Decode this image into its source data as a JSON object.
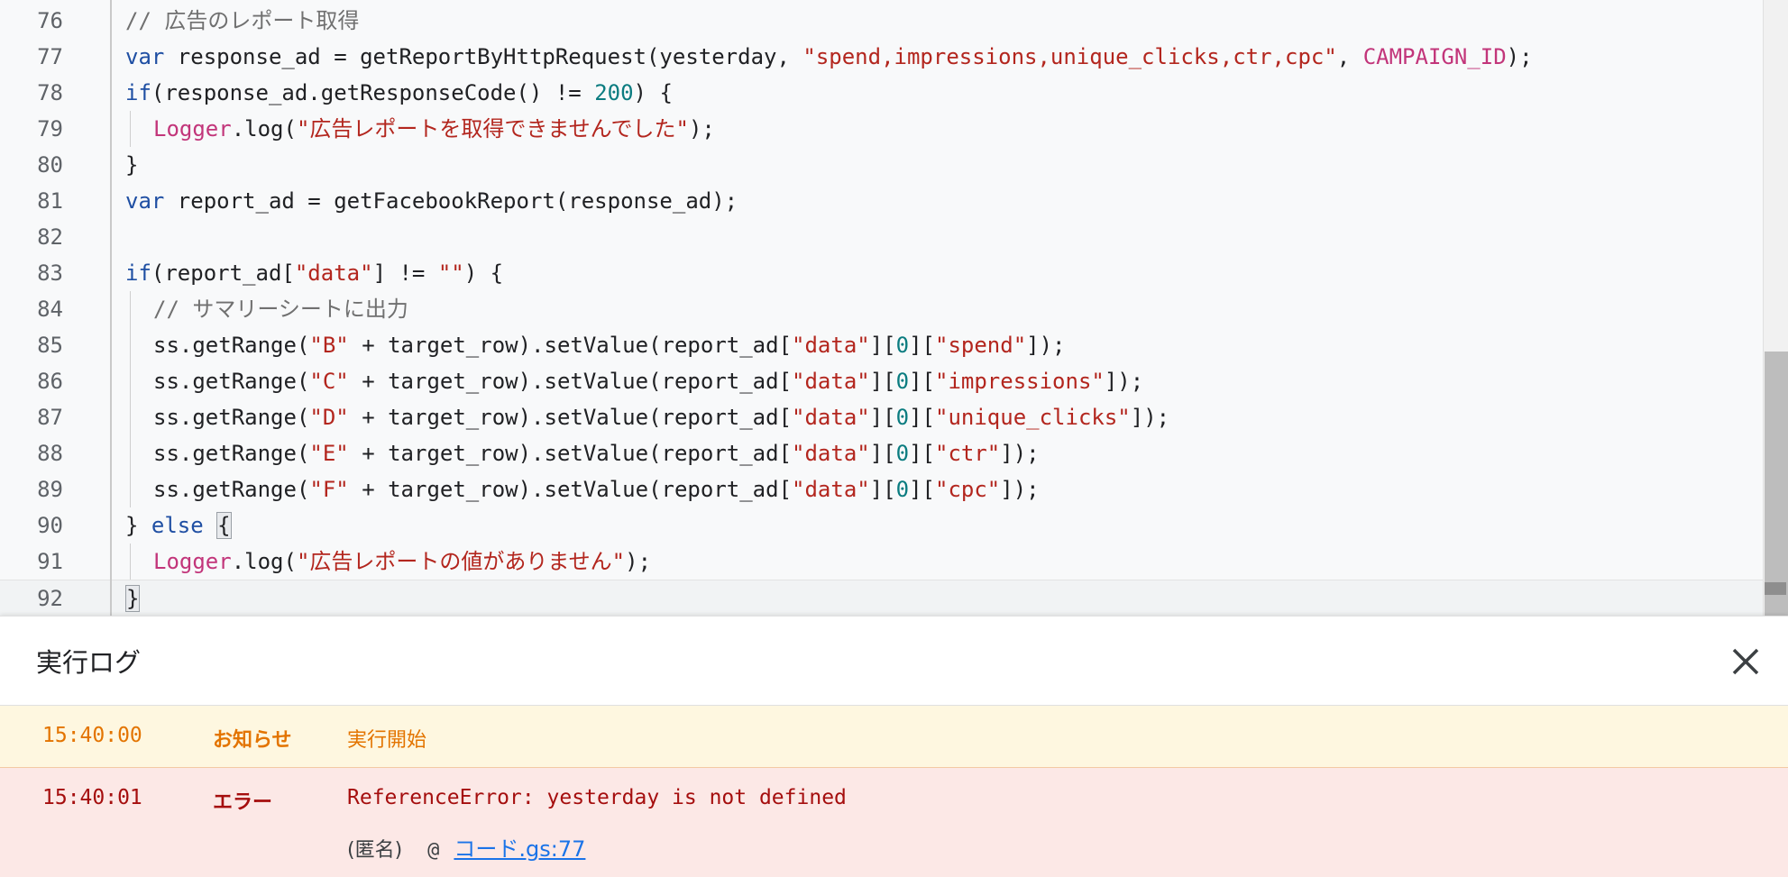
{
  "editor": {
    "lines": [
      {
        "n": "76",
        "indent": 0,
        "tokens": [
          {
            "t": "// 広告のレポート取得",
            "c": "cmt"
          }
        ]
      },
      {
        "n": "77",
        "indent": 0,
        "tokens": [
          {
            "t": "var",
            "c": "kw"
          },
          {
            "t": " response_ad = getReportByHttpRequest(yesterday, ",
            "c": ""
          },
          {
            "t": "\"spend,impressions,unique_clicks,ctr,cpc\"",
            "c": "str"
          },
          {
            "t": ", ",
            "c": ""
          },
          {
            "t": "CAMPAIGN_ID",
            "c": "const"
          },
          {
            "t": ");",
            "c": ""
          }
        ]
      },
      {
        "n": "78",
        "indent": 0,
        "tokens": [
          {
            "t": "if",
            "c": "kw"
          },
          {
            "t": "(response_ad.getResponseCode() != ",
            "c": ""
          },
          {
            "t": "200",
            "c": "num"
          },
          {
            "t": ") {",
            "c": ""
          }
        ]
      },
      {
        "n": "79",
        "indent": 1,
        "tokens": [
          {
            "t": "Logger",
            "c": "cls"
          },
          {
            "t": ".log(",
            "c": ""
          },
          {
            "t": "\"広告レポートを取得できませんでした\"",
            "c": "str"
          },
          {
            "t": ");",
            "c": ""
          }
        ]
      },
      {
        "n": "80",
        "indent": 0,
        "tokens": [
          {
            "t": "}",
            "c": ""
          }
        ]
      },
      {
        "n": "81",
        "indent": 0,
        "tokens": [
          {
            "t": "var",
            "c": "kw"
          },
          {
            "t": " report_ad = getFacebookReport(response_ad);",
            "c": ""
          }
        ]
      },
      {
        "n": "82",
        "indent": 0,
        "tokens": []
      },
      {
        "n": "83",
        "indent": 0,
        "tokens": [
          {
            "t": "if",
            "c": "kw"
          },
          {
            "t": "(report_ad[",
            "c": ""
          },
          {
            "t": "\"data\"",
            "c": "str"
          },
          {
            "t": "] != ",
            "c": ""
          },
          {
            "t": "\"\"",
            "c": "str"
          },
          {
            "t": ") {",
            "c": ""
          }
        ]
      },
      {
        "n": "84",
        "indent": 1,
        "tokens": [
          {
            "t": "// サマリーシートに出力",
            "c": "cmt"
          }
        ]
      },
      {
        "n": "85",
        "indent": 1,
        "tokens": [
          {
            "t": "ss.getRange(",
            "c": ""
          },
          {
            "t": "\"B\"",
            "c": "str"
          },
          {
            "t": " + target_row).setValue(report_ad[",
            "c": ""
          },
          {
            "t": "\"data\"",
            "c": "str"
          },
          {
            "t": "][",
            "c": ""
          },
          {
            "t": "0",
            "c": "num"
          },
          {
            "t": "][",
            "c": ""
          },
          {
            "t": "\"spend\"",
            "c": "str"
          },
          {
            "t": "]);",
            "c": ""
          }
        ]
      },
      {
        "n": "86",
        "indent": 1,
        "tokens": [
          {
            "t": "ss.getRange(",
            "c": ""
          },
          {
            "t": "\"C\"",
            "c": "str"
          },
          {
            "t": " + target_row).setValue(report_ad[",
            "c": ""
          },
          {
            "t": "\"data\"",
            "c": "str"
          },
          {
            "t": "][",
            "c": ""
          },
          {
            "t": "0",
            "c": "num"
          },
          {
            "t": "][",
            "c": ""
          },
          {
            "t": "\"impressions\"",
            "c": "str"
          },
          {
            "t": "]);",
            "c": ""
          }
        ]
      },
      {
        "n": "87",
        "indent": 1,
        "tokens": [
          {
            "t": "ss.getRange(",
            "c": ""
          },
          {
            "t": "\"D\"",
            "c": "str"
          },
          {
            "t": " + target_row).setValue(report_ad[",
            "c": ""
          },
          {
            "t": "\"data\"",
            "c": "str"
          },
          {
            "t": "][",
            "c": ""
          },
          {
            "t": "0",
            "c": "num"
          },
          {
            "t": "][",
            "c": ""
          },
          {
            "t": "\"unique_clicks\"",
            "c": "str"
          },
          {
            "t": "]);",
            "c": ""
          }
        ]
      },
      {
        "n": "88",
        "indent": 1,
        "tokens": [
          {
            "t": "ss.getRange(",
            "c": ""
          },
          {
            "t": "\"E\"",
            "c": "str"
          },
          {
            "t": " + target_row).setValue(report_ad[",
            "c": ""
          },
          {
            "t": "\"data\"",
            "c": "str"
          },
          {
            "t": "][",
            "c": ""
          },
          {
            "t": "0",
            "c": "num"
          },
          {
            "t": "][",
            "c": ""
          },
          {
            "t": "\"ctr\"",
            "c": "str"
          },
          {
            "t": "]);",
            "c": ""
          }
        ]
      },
      {
        "n": "89",
        "indent": 1,
        "tokens": [
          {
            "t": "ss.getRange(",
            "c": ""
          },
          {
            "t": "\"F\"",
            "c": "str"
          },
          {
            "t": " + target_row).setValue(report_ad[",
            "c": ""
          },
          {
            "t": "\"data\"",
            "c": "str"
          },
          {
            "t": "][",
            "c": ""
          },
          {
            "t": "0",
            "c": "num"
          },
          {
            "t": "][",
            "c": ""
          },
          {
            "t": "\"cpc\"",
            "c": "str"
          },
          {
            "t": "]);",
            "c": ""
          }
        ]
      },
      {
        "n": "90",
        "indent": 0,
        "tokens": [
          {
            "t": "} ",
            "c": ""
          },
          {
            "t": "else",
            "c": "kw"
          },
          {
            "t": " ",
            "c": ""
          },
          {
            "t": "{",
            "c": "",
            "box": true
          }
        ]
      },
      {
        "n": "91",
        "indent": 1,
        "tokens": [
          {
            "t": "Logger",
            "c": "cls"
          },
          {
            "t": ".log(",
            "c": ""
          },
          {
            "t": "\"広告レポートの値がありません\"",
            "c": "str"
          },
          {
            "t": ");",
            "c": ""
          }
        ]
      },
      {
        "n": "92",
        "indent": 0,
        "current": true,
        "tokens": [
          {
            "t": "}",
            "c": "",
            "box": true
          }
        ]
      }
    ]
  },
  "log": {
    "title": "実行ログ",
    "close_icon": "close-icon",
    "entries": [
      {
        "time": "15:40:00",
        "level": "お知らせ",
        "message": "実行開始"
      },
      {
        "time": "15:40:01",
        "level": "エラー",
        "message": "ReferenceError: yesterday is not defined",
        "stack_label": "(匿名)",
        "stack_at": "@",
        "stack_link": "コード.gs:77"
      }
    ]
  },
  "colors": {
    "keyword": "#1f4fa3",
    "string": "#b3261e",
    "number": "#0b7c80",
    "comment": "#707070",
    "constant": "#c2357a",
    "notice_bg": "#fef7e0",
    "notice_text": "#e37400",
    "error_bg": "#fce8e6",
    "error_text": "#a50e0e",
    "link": "#1a73e8"
  }
}
